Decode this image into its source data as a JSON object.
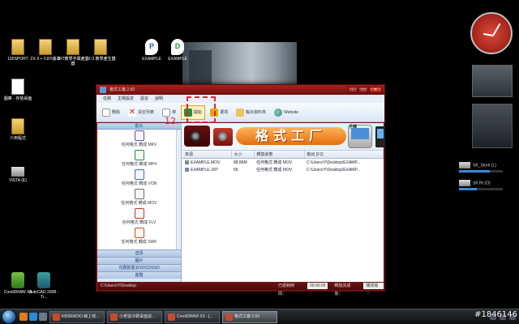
{
  "desktop": {
    "icons_left": [
      {
        "label": "100SPORT",
        "kind": "folder"
      },
      {
        "label": "ZX-3 + 0.87i版本",
        "kind": "folder"
      },
      {
        "label": "1RT教學字幕產生器",
        "kind": "folder"
      },
      {
        "label": "ZX-3 教學產生器",
        "kind": "folder"
      },
      {
        "label": "EXAMPLE",
        "kind": "bubble-blue"
      },
      {
        "label": "EXAMPLE",
        "kind": "bubble-green"
      }
    ],
    "icons_col": [
      {
        "label": "圖庫 - 存放桌面",
        "kind": "doc"
      },
      {
        "label": "少用程式",
        "kind": "folder"
      },
      {
        "label": "VISTA (E)",
        "kind": "drive"
      },
      {
        "label": "CorelDRAW X3",
        "kind": "app"
      },
      {
        "label": "AutoCAD 2008 - Tr...",
        "kind": "app"
      }
    ],
    "gadget_drives": [
      {
        "label": "SK_Stor6 (L)",
        "fill": 0.7
      },
      {
        "label": "SK Rt (O)",
        "fill": 0.4
      }
    ]
  },
  "window": {
    "title": "格式工廠 2.60",
    "menu": [
      "任務",
      "主題設定",
      "語言",
      "說明"
    ],
    "toolbar": [
      {
        "label": "刪除",
        "icon": "doc-icon",
        "highlight": false
      },
      {
        "label": "清空列表",
        "icon": "x-icon",
        "highlight": false
      },
      {
        "label": "停",
        "icon": "doc-icon",
        "highlight": false
      },
      {
        "label": "開始",
        "icon": "play-icon",
        "highlight": true
      },
      {
        "label": "選項",
        "icon": "stop-icon",
        "highlight": false
      },
      {
        "label": "輸出資料夾",
        "icon": "folder-icon",
        "highlight": false
      },
      {
        "label": "Website",
        "icon": "globe-icon",
        "highlight": false
      }
    ],
    "sidebar": {
      "header": "影片",
      "items": [
        "任何格式 轉成 MKV",
        "任何格式 轉成 MP4",
        "任何格式 轉成 VOB",
        "任何格式 轉成 MOV",
        "任何格式 轉成 FLV",
        "任何格式 轉成 SWF"
      ],
      "categories": [
        "音訊",
        "圖片",
        "光碟裝置\\DVD\\CD\\ISO",
        "進階"
      ]
    },
    "banner": {
      "brand": "格式工厂",
      "device_badge": "手機"
    },
    "table": {
      "columns": [
        "來源",
        "大小",
        "轉換狀態",
        "輸出 [F2]"
      ],
      "rows": [
        [
          "EXAMPLE.MOV",
          "88.86M",
          "任何格式 轉成 MOV",
          "C:\\Users\\Y\\Desktop\\EXAMP..."
        ],
        [
          "EXAMPLE.1RT",
          "5K",
          "任何格式 轉成 MOV",
          "C:\\Users\\Y\\Desktop\\EXAMP..."
        ]
      ]
    },
    "status": {
      "path": "C:\\Users\\Y\\Desktop",
      "elapsed_label": "已經耗時間：",
      "elapsed_value": "00:00:00",
      "after_label": "轉換完成後：",
      "after_value": "關閉電腦"
    }
  },
  "annotation": {
    "number": "12."
  },
  "taskbar": {
    "buttons": [
      {
        "label": "KBSRADIO 線上收...",
        "active": false
      },
      {
        "label": "小老鼠冷僻桌面說...",
        "active": false
      },
      {
        "label": "CorelDRAW X3 - [...",
        "active": false
      },
      {
        "label": "格式工廠 2.60",
        "active": true
      }
    ]
  },
  "watermark": "#1846146"
}
